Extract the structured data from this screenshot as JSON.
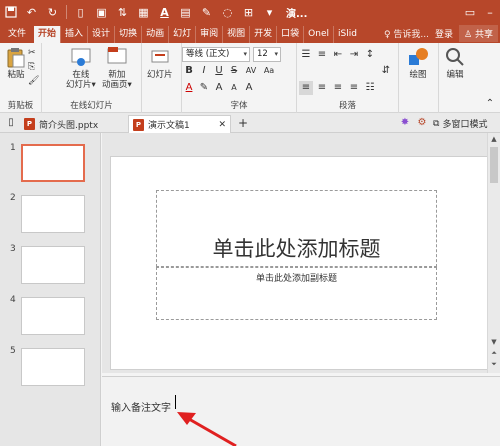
{
  "qat": {
    "doc_title": "演..."
  },
  "tabs": [
    "文件",
    "开始",
    "插入",
    "设计",
    "切换",
    "动画",
    "幻灯",
    "审阅",
    "视图",
    "开发",
    "口袋",
    "Onel",
    "iSlid"
  ],
  "tellme": "♀ 告诉我...",
  "login": "登录",
  "share": "共享",
  "ribbon": {
    "paste": "粘贴",
    "clipboard": "剪贴板",
    "online_slides": "在线\n幻灯片▾",
    "new_anim": "新加\n动画页▾",
    "online_group": "在线幻灯片",
    "slides_btn": "幻灯片",
    "font_name": "等线 (正文)",
    "font_size": "12",
    "font_group": "字体",
    "para_group": "段落",
    "draw": "绘图",
    "edit": "编辑"
  },
  "doctabs": [
    {
      "label": "简介头图.pptx"
    },
    {
      "label": "演示文稿1"
    }
  ],
  "right_tools": {
    "multi_window": "多窗口模式"
  },
  "slide_numbers": [
    "1",
    "2",
    "3",
    "4",
    "5"
  ],
  "slide": {
    "title_placeholder": "单击此处添加标题",
    "subtitle_placeholder": "单击此处添加副标题"
  },
  "notes": {
    "placeholder": "输入备注文字"
  },
  "colors": {
    "accent": "#b7472a",
    "selection": "#e46b4d",
    "arrow": "#e02020"
  }
}
